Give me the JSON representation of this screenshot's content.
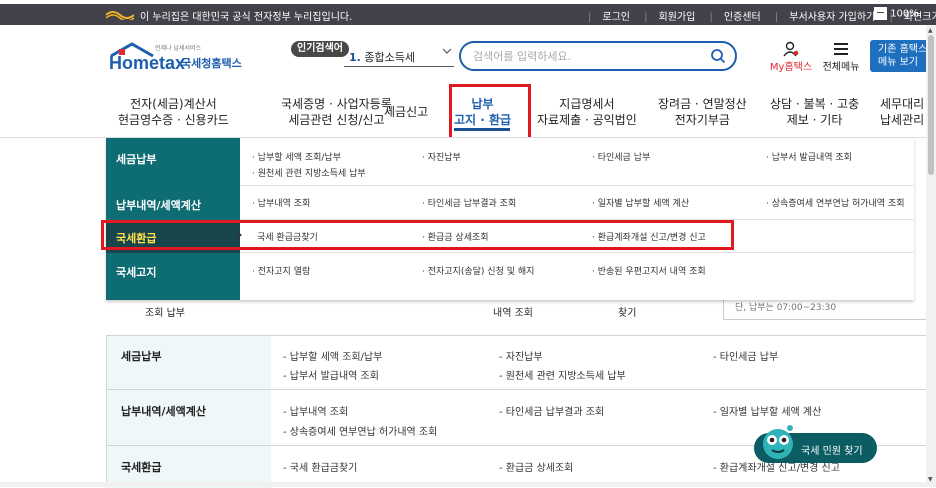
{
  "govbar": {
    "message": "이 누리집은 대한민국 공식 전자정부 누리집입니다.",
    "links": [
      "로그인",
      "회원가입",
      "인증센터",
      "부서사용자 가입하기",
      "화면크기"
    ],
    "zoom_level": "100%",
    "zoom_out": "−",
    "zoom_in": "+"
  },
  "header": {
    "logo_sub": "언제나 납세서비스",
    "logo_text": "Hometax",
    "logo_org": "국세청홈택스",
    "popular_badge": "인기검색어",
    "popular_rank": "1.",
    "popular_keyword": "종합소득세",
    "search_placeholder": "검색어를 입력하세요.",
    "mytax_label": "My홈택스",
    "allmenu_label": "전체메뉴",
    "biz_button_line1": "기존 홈택스",
    "biz_button_line2": "메뉴 보기"
  },
  "gnb": [
    {
      "line1": "전자(세금)계산서",
      "line2": "현금영수증 · 신용카드"
    },
    {
      "line1": "국세증명 · 사업자등록",
      "line2": "세금관련 신청/신고"
    },
    {
      "line1": "세금신고",
      "line2": ""
    },
    {
      "line1": "납부",
      "line2": "고지 · 환급"
    },
    {
      "line1": "지급명세서",
      "line2": "자료제출 · 공익법인"
    },
    {
      "line1": "장려금 · 연말정산",
      "line2": "전자기부금"
    },
    {
      "line1": "상담 · 불복 · 고충",
      "line2": "제보 · 기타"
    },
    {
      "line1": "세무대리",
      "line2": "납세관리"
    }
  ],
  "dropdown": {
    "categories": [
      "세금납부",
      "납부내역/세액계산",
      "국세환급",
      "국세고지"
    ],
    "rows": [
      [
        "· 납부할 세액 조회/납부",
        "· 자진납부",
        "· 타인세금 납부",
        "· 납부서 발급내역 조회",
        "· 원천세 관련 지방소득세 납부"
      ],
      [
        "· 납부내역 조회",
        "· 타인세금 납부결과 조회",
        "· 일자별 납부할 세액 계산",
        "· 상속증여세 연부연납 허가내역 조회"
      ],
      [
        "국세 환급금찾기",
        "· 환급금 상세조회",
        "· 환급계좌개설 신고/변경 신고"
      ],
      [
        "· 전자고지 열람",
        "· 전자고지(송달) 신청 및 해지",
        "· 반송된 우편고지서 내역 조회"
      ]
    ]
  },
  "background": {
    "partial_items": [
      "조회 납부",
      "내역 조회",
      "찾기"
    ],
    "info_text": "단, 납부는 07:00~23:30"
  },
  "section": {
    "categories": [
      "세금납부",
      "납부내역/세액계산",
      "국세환급"
    ],
    "rows": [
      [
        "- 납부할 세액 조회/납부",
        "- 자진납부",
        "- 타인세금 납부",
        "- 납부서 발급내역 조회",
        "- 원천세 관련 지방소득세 납부"
      ],
      [
        "- 납부내역 조회",
        "- 타인세금 납부결과 조회",
        "- 일자별 납부할 세액 계산",
        "- 상속증여세 연부연납 허가내역 조회"
      ],
      [
        "- 국세 환급금찾기",
        "- 환급금 상세조회",
        "- 환급계좌개설 신고/변경 신고"
      ]
    ]
  },
  "chatbot": {
    "label": "국세 민원 찾기"
  },
  "colors": {
    "brand": "#1d5fae",
    "dropdown_bg": "#0e6c73",
    "highlight": "#e0181f"
  }
}
